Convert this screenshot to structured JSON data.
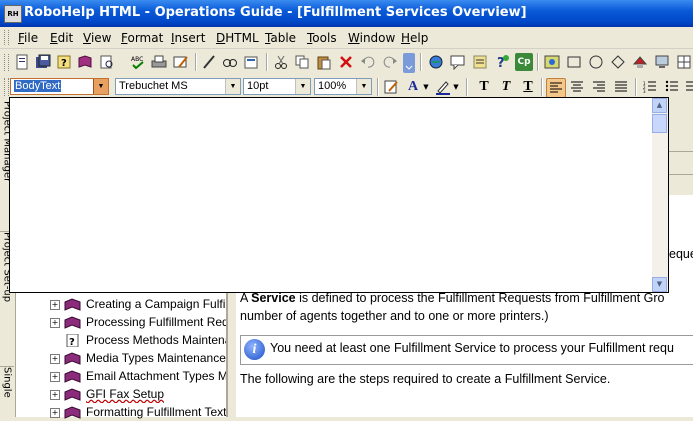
{
  "window": {
    "app_icon_text": "RH",
    "title": "RoboHelp HTML - Operations Guide - [Fulfillment Services Overview]"
  },
  "menu": [
    "File",
    "Edit",
    "View",
    "Format",
    "Insert",
    "DHTML",
    "Table",
    "Tools",
    "Window",
    "Help"
  ],
  "format_toolbar": {
    "style_value": "BodyText",
    "font_value": "Trebuchet MS",
    "size_value": "10pt",
    "zoom_value": "100%"
  },
  "toolbar_icons": [
    "new-topic-icon",
    "save-all-icon",
    "help-topic-icon",
    "book-icon",
    "print-preview-icon",
    "spell-check-icon",
    "print-icon",
    "pencil-icon",
    "find-icon",
    "thesaurus-icon",
    "cut-icon",
    "copy-icon",
    "paste-icon",
    "delete-icon",
    "undo-icon",
    "redo-icon",
    "hyperlink-icon",
    "comment-icon",
    "glossary-icon",
    "help-icon",
    "captivate-icon",
    "image-icon",
    "rectangle-icon",
    "ellipse-icon",
    "polygon-icon",
    "hotspot-icon",
    "monitor-icon",
    "grid-icon"
  ],
  "left_tabs": {
    "project_manager": "Project Manager",
    "project_set_up": "Project Set-up",
    "single_source": "Single"
  },
  "tree_items": [
    {
      "label": "Creating a Campaign Fulfillme",
      "icon": "book-icon",
      "expandable": true
    },
    {
      "label": "Processing Fulfillment Reque",
      "icon": "book-icon",
      "expandable": true
    },
    {
      "label": "Process Methods Maintenar",
      "icon": "help-page-icon",
      "expandable": false
    },
    {
      "label": "Media Types Maintenance",
      "icon": "book-icon",
      "expandable": true
    },
    {
      "label": "Email Attachment Types Mai",
      "icon": "book-icon",
      "expandable": true
    },
    {
      "label": "GFI Fax Setup",
      "icon": "book-icon",
      "expandable": true
    },
    {
      "label": "Formatting Fulfillment Text",
      "icon": "book-icon",
      "expandable": true
    }
  ],
  "document": {
    "right_clip_text": "eque",
    "para1_prefix": "A ",
    "para1_bold": "Service",
    "para1_rest": " is defined to process the Fulfillment Requests from Fulfillment Gro",
    "para1_line2": "number of agents together and to one or more printers.)",
    "note_text": "You need at least one Fulfillment Service to process your Fulfillment requ",
    "para2": "The following are the steps required to create a Fulfillment Service."
  },
  "colors": {
    "titlebar": "#0a5ad8",
    "book_icon": "#8a2b7c",
    "selection": "#316ac5"
  }
}
